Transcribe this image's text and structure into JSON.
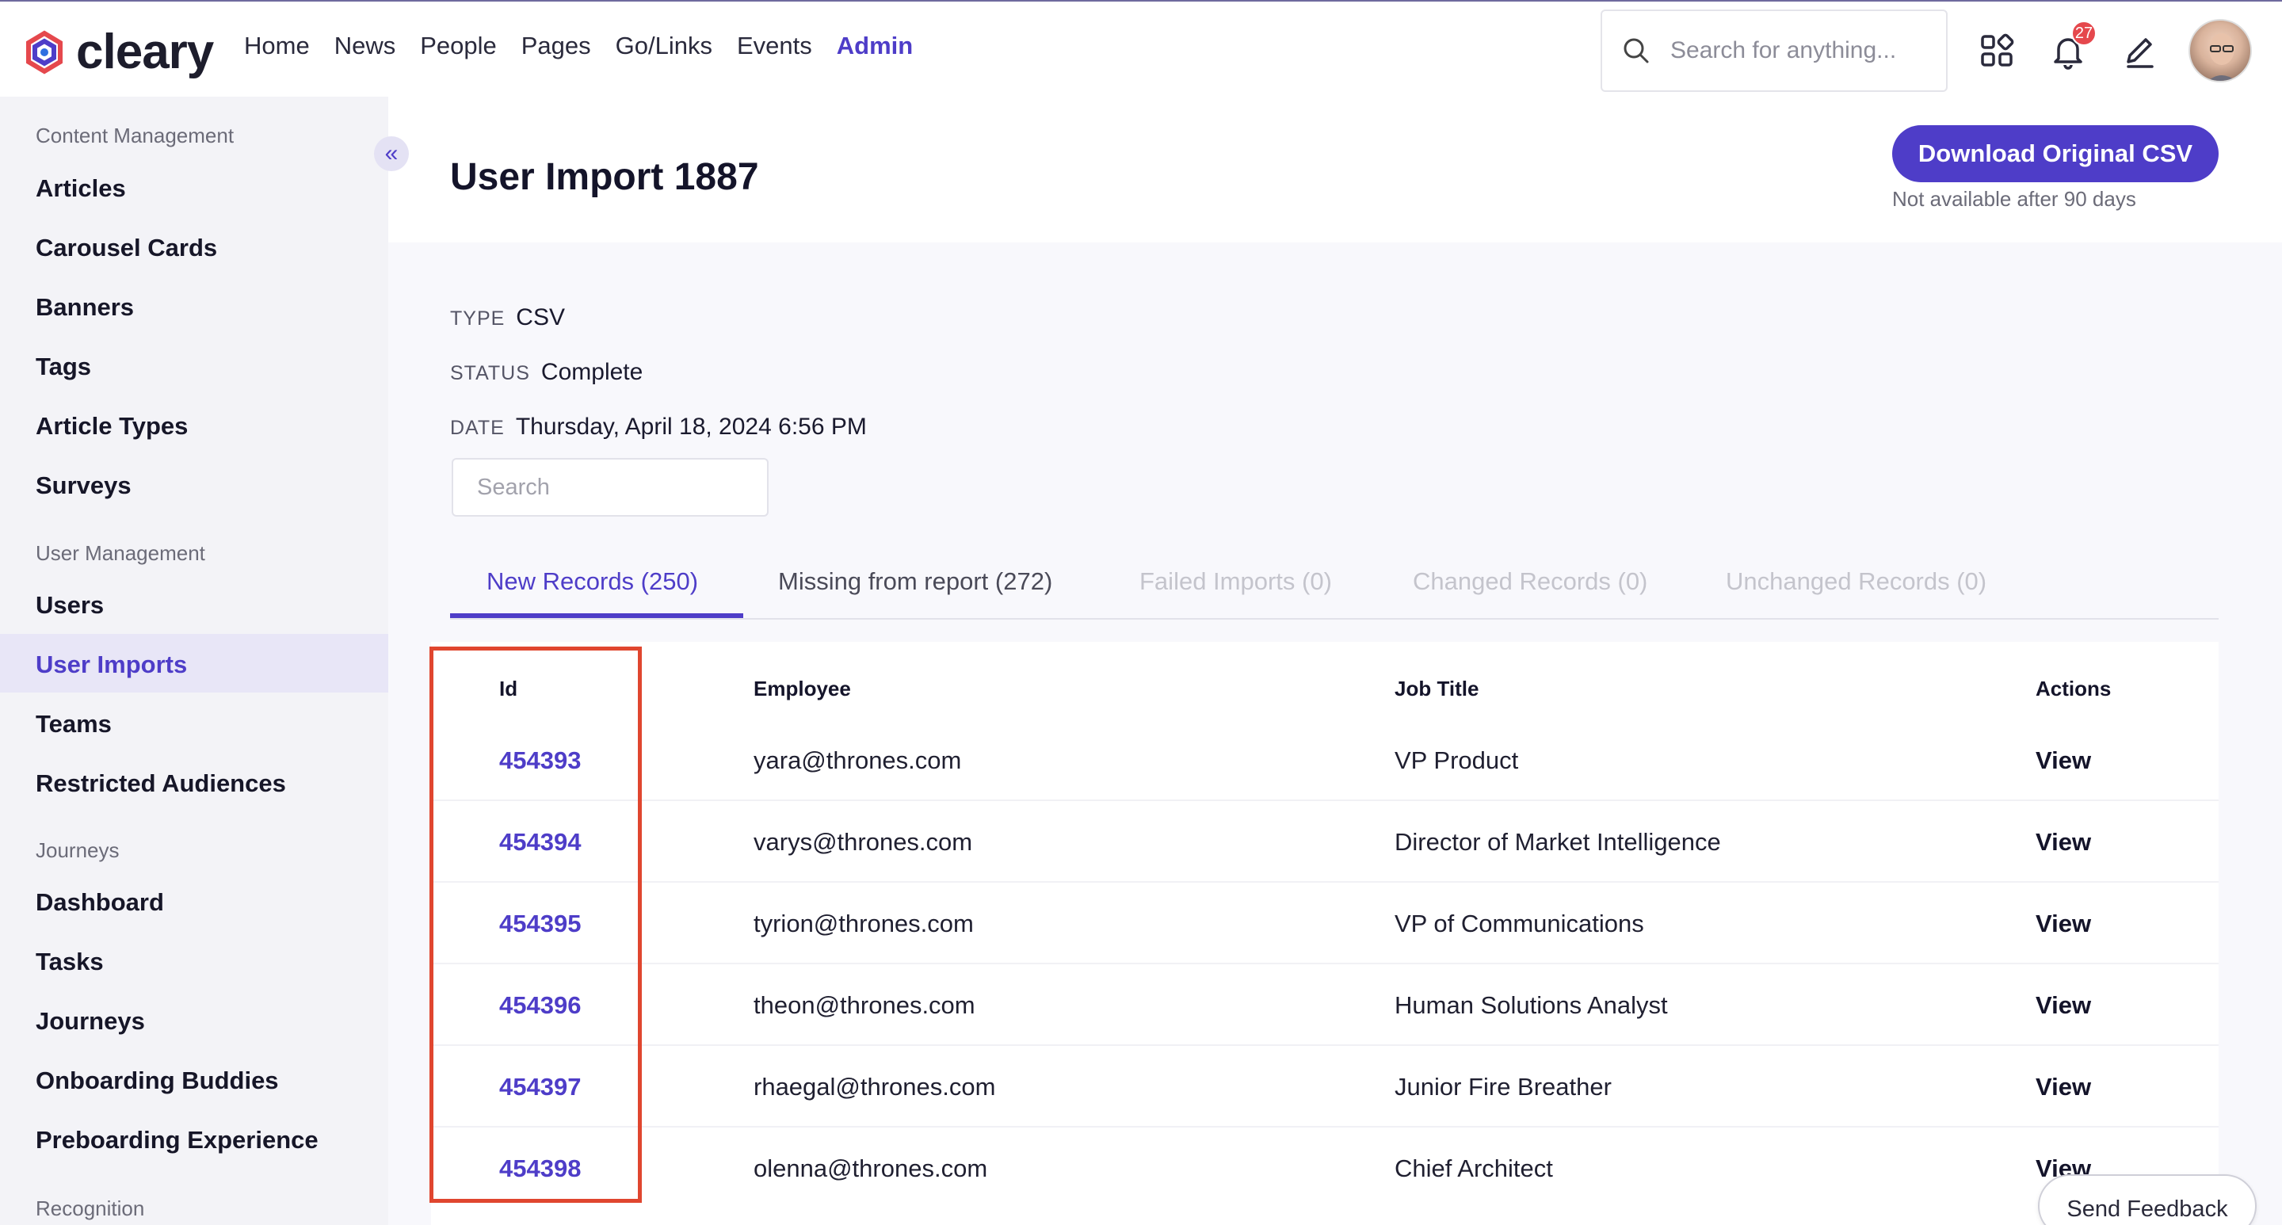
{
  "brand": {
    "name": "cleary",
    "accent": "#4e3dc8"
  },
  "nav": {
    "links": [
      "Home",
      "News",
      "People",
      "Pages",
      "Go/Links",
      "Events",
      "Admin"
    ],
    "active": "Admin",
    "search_placeholder": "Search for anything...",
    "notification_count": "27",
    "icons": [
      "apps-grid-icon",
      "bell-icon",
      "pencil-icon",
      "avatar"
    ]
  },
  "sidebar": {
    "sections": [
      {
        "title": "Content Management",
        "items": [
          "Articles",
          "Carousel Cards",
          "Banners",
          "Tags",
          "Article Types",
          "Surveys"
        ]
      },
      {
        "title": "User Management",
        "items": [
          "Users",
          "User Imports",
          "Teams",
          "Restricted Audiences"
        ]
      },
      {
        "title": "Journeys",
        "items": [
          "Dashboard",
          "Tasks",
          "Journeys",
          "Onboarding Buddies",
          "Preboarding Experience"
        ]
      },
      {
        "title": "Recognition",
        "items": []
      }
    ],
    "active_item": "User Imports"
  },
  "page": {
    "title": "User Import 1887",
    "download_button": "Download Original CSV",
    "download_note": "Not available after 90 days",
    "meta": [
      {
        "key": "TYPE",
        "value": "CSV"
      },
      {
        "key": "STATUS",
        "value": "Complete"
      },
      {
        "key": "DATE",
        "value": "Thursday, April 18, 2024 6:56 PM"
      }
    ],
    "search_placeholder": "Search"
  },
  "tabs": [
    {
      "label": "New Records (250)",
      "state": "active"
    },
    {
      "label": "Missing from report (272)",
      "state": "normal"
    },
    {
      "label": "Failed Imports (0)",
      "state": "disabled"
    },
    {
      "label": "Changed Records (0)",
      "state": "disabled"
    },
    {
      "label": "Unchanged Records (0)",
      "state": "disabled"
    }
  ],
  "table": {
    "columns": [
      "Id",
      "Employee",
      "Job Title",
      "Actions"
    ],
    "rows": [
      {
        "id": "454393",
        "employee": "yara@thrones.com",
        "job_title": "VP Product",
        "action": "View"
      },
      {
        "id": "454394",
        "employee": "varys@thrones.com",
        "job_title": "Director of Market Intelligence",
        "action": "View"
      },
      {
        "id": "454395",
        "employee": "tyrion@thrones.com",
        "job_title": "VP of Communications",
        "action": "View"
      },
      {
        "id": "454396",
        "employee": "theon@thrones.com",
        "job_title": "Human Solutions Analyst",
        "action": "View"
      },
      {
        "id": "454397",
        "employee": "rhaegal@thrones.com",
        "job_title": "Junior Fire Breather",
        "action": "View"
      },
      {
        "id": "454398",
        "employee": "olenna@thrones.com",
        "job_title": "Chief Architect",
        "action": "View"
      }
    ]
  },
  "feedback_button": "Send Feedback"
}
